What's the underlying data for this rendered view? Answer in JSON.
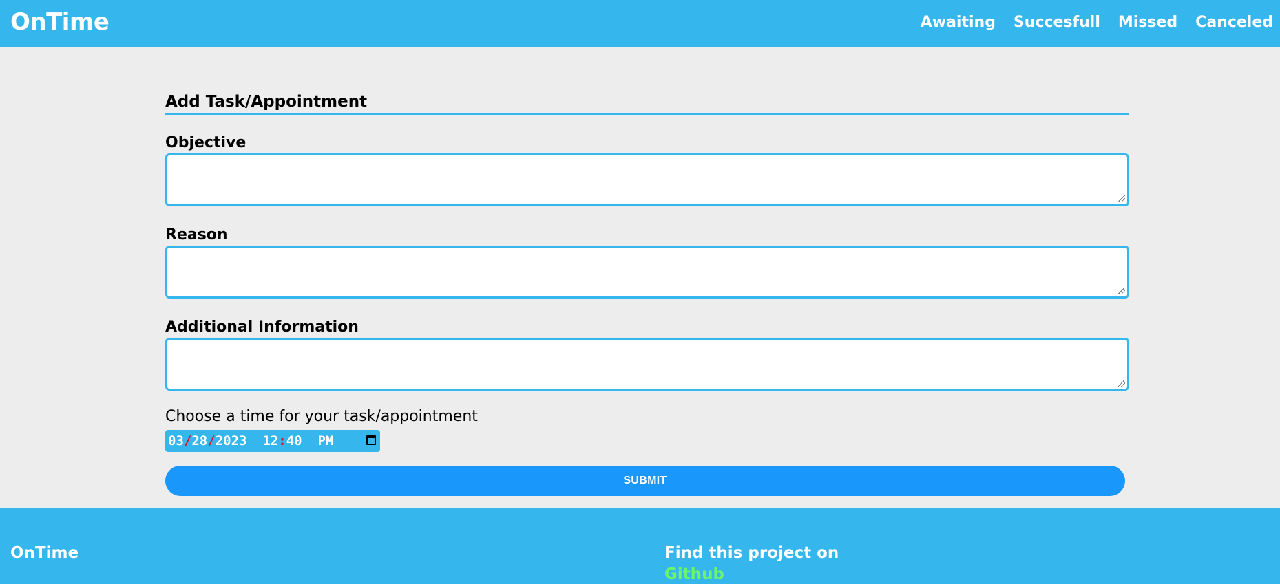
{
  "header": {
    "brand": "OnTime",
    "nav": [
      "Awaiting",
      "Succesfull",
      "Missed",
      "Canceled"
    ]
  },
  "form": {
    "title": "Add Task/Appointment",
    "fields": [
      {
        "label": "Objective",
        "value": ""
      },
      {
        "label": "Reason",
        "value": ""
      },
      {
        "label": "Additional Information",
        "value": ""
      }
    ],
    "time_label": "Choose a time for your task/appointment",
    "datetime": {
      "month": "03",
      "day": "28",
      "year": "2023",
      "hour": "12",
      "minute": "40",
      "ampm": "PM"
    },
    "submit_label": "SUBMIT"
  },
  "footer": {
    "brand": "OnTime",
    "find_text": "Find this project on",
    "link_text": "Github"
  },
  "colors": {
    "primary": "#35b6ec",
    "submit": "#1997fb",
    "background": "#ededed",
    "link": "#6bf56b",
    "separator": "#e0102a"
  }
}
